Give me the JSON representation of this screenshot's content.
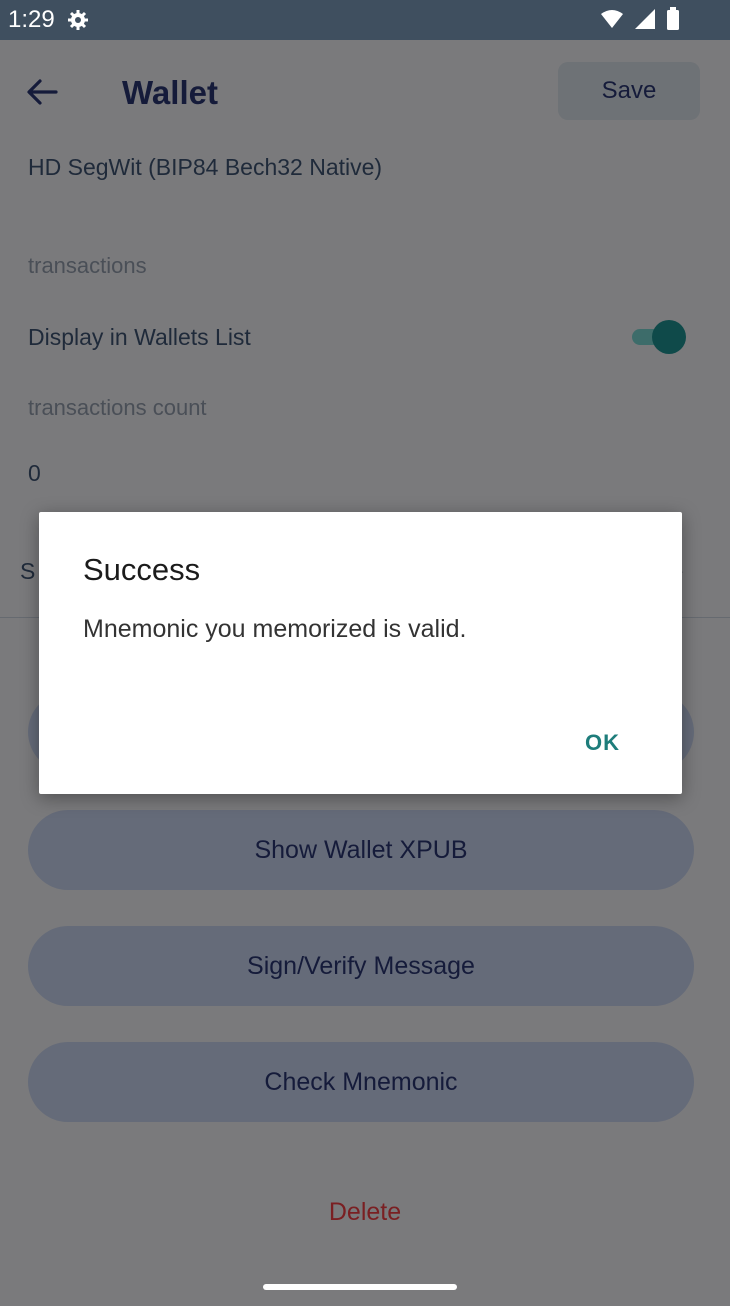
{
  "status_bar": {
    "time": "1:29",
    "icons": [
      "gear-icon",
      "wifi-icon",
      "signal-icon",
      "battery-icon"
    ]
  },
  "header": {
    "title": "Wallet",
    "save_label": "Save"
  },
  "wallet": {
    "type": "HD SegWit (BIP84 Bech32 Native)",
    "transactions_label": "transactions",
    "display_in_list_label": "Display in Wallets List",
    "display_in_list_enabled": true,
    "tx_count_label": "transactions count",
    "tx_count_value": "0",
    "partial_row_letter": "S"
  },
  "buttons": {
    "show_xpub": "Show Wallet XPUB",
    "sign_verify": "Sign/Verify Message",
    "check_mnemonic": "Check Mnemonic",
    "delete": "Delete"
  },
  "dialog": {
    "title": "Success",
    "message": "Mnemonic you memorized is valid.",
    "ok_label": "OK"
  },
  "colors": {
    "accent": "#1e7d7b",
    "delete": "#7a1f22",
    "status_bar": "#3f4f5f"
  }
}
